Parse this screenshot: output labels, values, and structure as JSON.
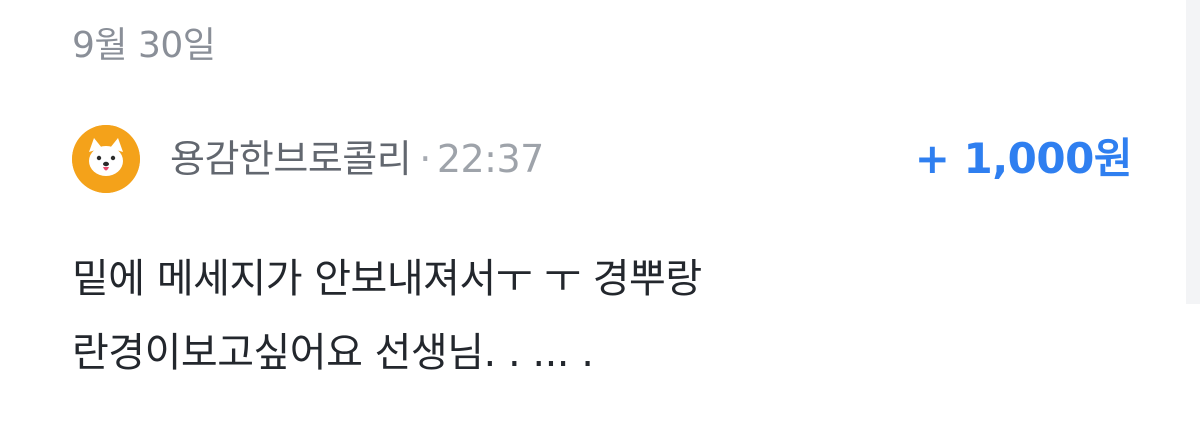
{
  "date": {
    "label": "9월 30일"
  },
  "entry": {
    "avatar_icon": "dog-face-icon",
    "sender": "용감한브로콜리",
    "separator": "·",
    "time": "22:37",
    "amount": "+ 1,000원",
    "message_lines": [
      "밑에 메세지가 안보내져서ㅜ ㅜ 경뿌랑",
      "란경이보고싶어요 선생님. . ... ."
    ]
  },
  "colors": {
    "amount": "#2f7ff0",
    "avatar_bg": "#f4a21a"
  }
}
